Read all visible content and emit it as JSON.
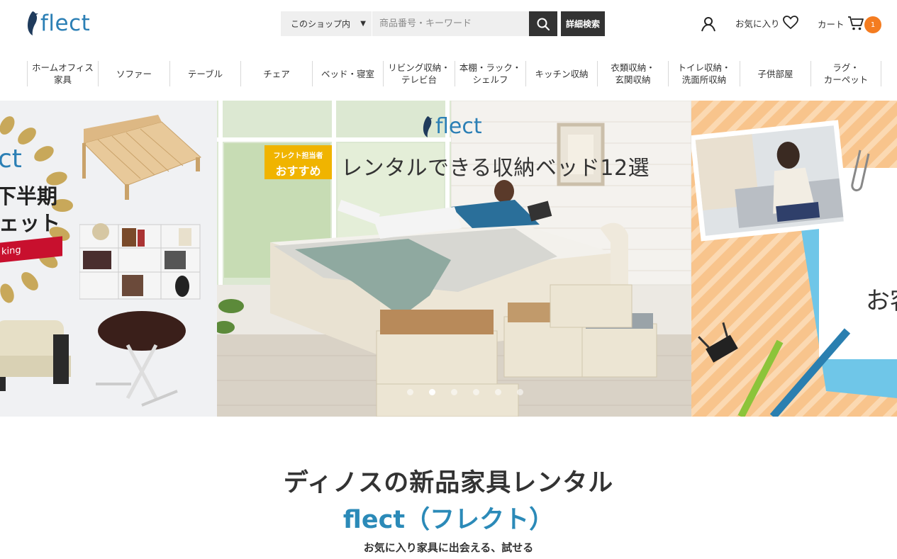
{
  "header": {
    "logo_text": "flect",
    "search": {
      "scope_label": "このショップ内",
      "placeholder": "商品番号・キーワード",
      "advanced_label": "詳細検索"
    },
    "favorites_label": "お気に入り",
    "cart_label": "カート",
    "cart_count": "1"
  },
  "nav": {
    "items": [
      {
        "label": "ホームオフィス\n家具"
      },
      {
        "label": "ソファー"
      },
      {
        "label": "テーブル"
      },
      {
        "label": "チェア"
      },
      {
        "label": "ベッド・寝室"
      },
      {
        "label": "リビング収納・\nテレビ台"
      },
      {
        "label": "本棚・ラック・\nシェルフ"
      },
      {
        "label": "キッチン収納"
      },
      {
        "label": "衣類収納・\n玄関収納"
      },
      {
        "label": "トイレ収納・\n洗面所収納"
      },
      {
        "label": "子供部屋"
      },
      {
        "label": "ラグ・\nカーペット"
      }
    ]
  },
  "hero": {
    "logo_text": "flect",
    "tag_line1": "フレクト担当者",
    "tag_line2": "おすすめ",
    "title": "レンタルできる収納ベッド12選",
    "slides_count": 6,
    "active_slide": 2,
    "left_panel": {
      "logo_fragment": "ct",
      "line1": "下半期",
      "line2": "ェット",
      "ribbon": "king"
    },
    "right_panel": {
      "text_fragment": "お客"
    }
  },
  "intro": {
    "title": "ディノスの新品家具レンタル",
    "brand": "flect（フレクト）",
    "tagline": "お気に入り家具に出会える、試せる"
  },
  "colors": {
    "brand_blue": "#2b7fb5",
    "accent_orange": "#f47c20",
    "tag_yellow": "#f0b400",
    "dark_button": "#333333"
  }
}
